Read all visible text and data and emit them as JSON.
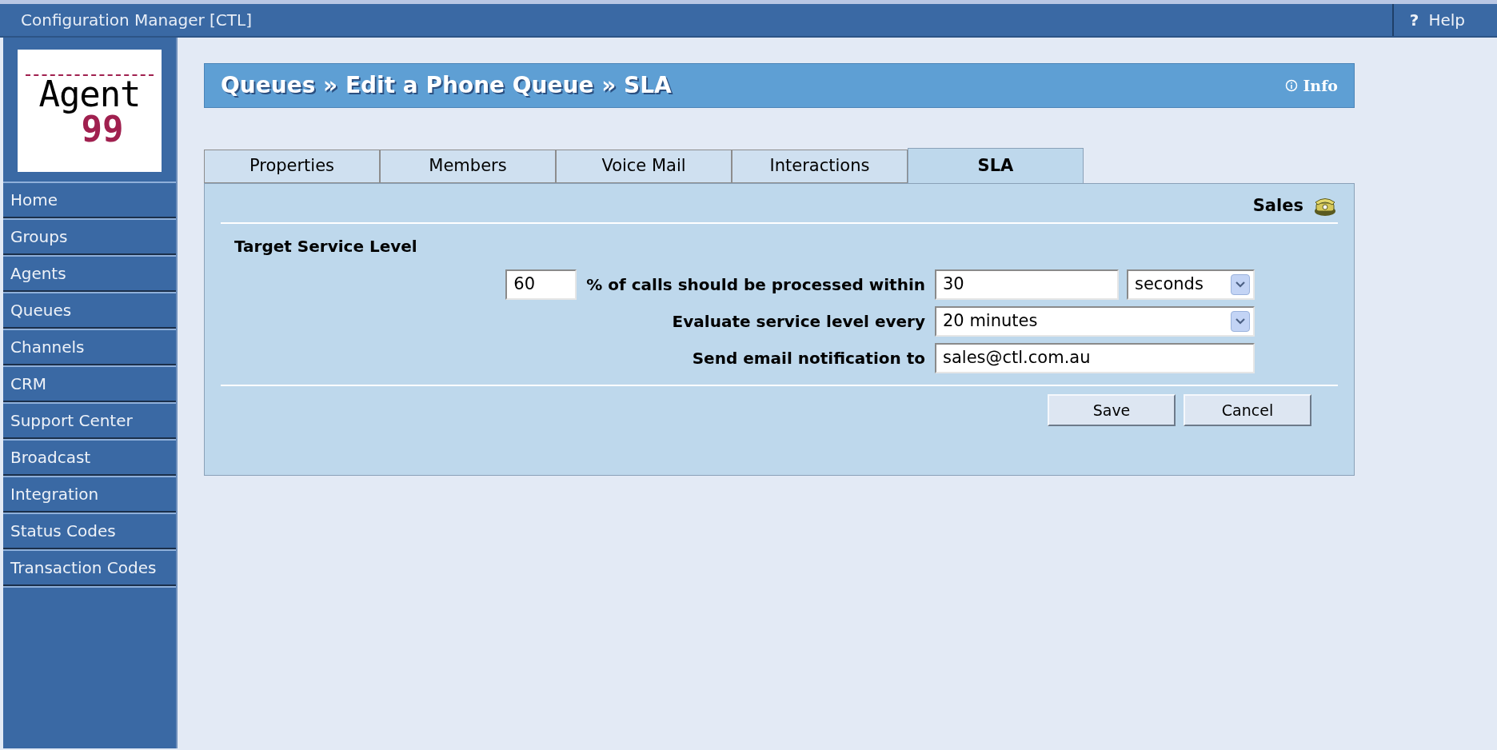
{
  "app_bar": {
    "title": "Configuration Manager [CTL]",
    "help": {
      "icon": "?",
      "label": "Help"
    }
  },
  "logo": {
    "word": "Agent",
    "number": "99"
  },
  "sidebar": {
    "items": [
      {
        "label": "Home",
        "selected": false
      },
      {
        "label": "Groups",
        "selected": false
      },
      {
        "label": "Agents",
        "selected": false
      },
      {
        "label": "Queues",
        "selected": false
      },
      {
        "label": "Channels",
        "selected": false
      },
      {
        "label": "CRM",
        "selected": false
      },
      {
        "label": "Support Center",
        "selected": false
      },
      {
        "label": "Broadcast",
        "selected": false
      },
      {
        "label": "Integration",
        "selected": false
      },
      {
        "label": "Status Codes",
        "selected": false
      },
      {
        "label": "Transaction Codes",
        "selected": false
      }
    ]
  },
  "header": {
    "title": "Queues » Edit a Phone Queue » SLA",
    "info": "Info"
  },
  "tabs": [
    {
      "label": "Properties",
      "selected": false
    },
    {
      "label": "Members",
      "selected": false
    },
    {
      "label": "Voice Mail",
      "selected": false
    },
    {
      "label": "Interactions",
      "selected": false
    },
    {
      "label": "SLA",
      "selected": true
    }
  ],
  "panel": {
    "queue_name": "Sales",
    "section": "Target Service Level",
    "percent": {
      "value": "60"
    },
    "rows": [
      {
        "label": "% of calls should be processed within",
        "kind": "number_unit",
        "value": "30",
        "unit": "seconds"
      },
      {
        "label": "Evaluate service level every",
        "kind": "select",
        "value": "20 minutes"
      },
      {
        "label": "Send email notification to",
        "kind": "text",
        "value": "sales@ctl.com.au"
      }
    ],
    "buttons": [
      "Save",
      "Cancel"
    ]
  }
}
